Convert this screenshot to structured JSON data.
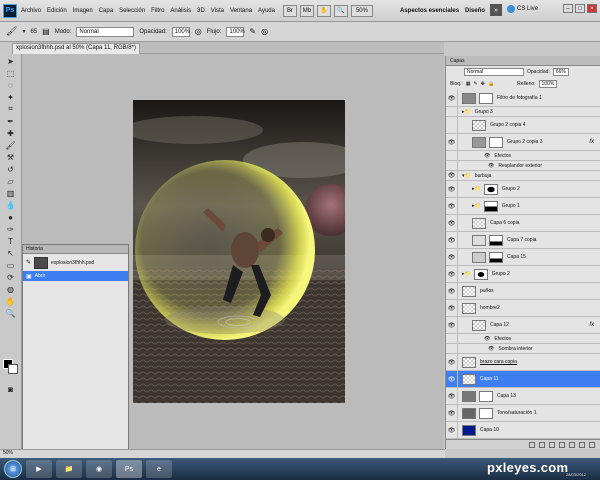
{
  "menubar": {
    "logo": "Ps",
    "menu_items": [
      "Archivo",
      "Edición",
      "Imagen",
      "Capa",
      "Selección",
      "Filtro",
      "Análisis",
      "3D",
      "Vista",
      "Ventana",
      "Ayuda"
    ],
    "zoom": "50%",
    "workspace_1": "Aspectos esenciales",
    "workspace_2": "Diseño",
    "expand_label": "»",
    "cs_live": "CS Live"
  },
  "options_bar": {
    "mode_label": "Modo:",
    "mode_value": "Normal",
    "opacity_label": "Opacidad:",
    "opacity_value": "100%",
    "flow_label": "Flujo:",
    "flow_value": "100%",
    "brush_size": "65"
  },
  "document": {
    "tab_title": "xplosion3fhhh.psd al 50% (Capa 11, RGB/8*)",
    "status_zoom": "50%"
  },
  "history": {
    "title": "Historia",
    "items": [
      {
        "label": "explosion3fhhh.psd"
      },
      {
        "label": "Abrir"
      }
    ]
  },
  "layers": {
    "tab_label": "Capas",
    "blend_mode": "Normal",
    "opacity_label": "Opacidad:",
    "opacity_value": "66%",
    "lock_label": "Bloq.:",
    "fill_label": "Relleno:",
    "fill_value": "100%",
    "rows": [
      {
        "name": "Filtro de fotografía 1"
      },
      {
        "name": "Grupo 3"
      },
      {
        "name": "Grupo 2 copia 4"
      },
      {
        "name": "Grupo 2 copia 3"
      },
      {
        "name": "Efectos"
      },
      {
        "name": "Resplandor exterior"
      },
      {
        "name": "burbuja"
      },
      {
        "name": "Grupo 2"
      },
      {
        "name": "Grupo 1"
      },
      {
        "name": "Capa 6 copia"
      },
      {
        "name": "Capa 7 copia"
      },
      {
        "name": "Capa 15"
      },
      {
        "name": "Grupo 2"
      },
      {
        "name": "puños"
      },
      {
        "name": "hombre2"
      },
      {
        "name": "Capa 12"
      },
      {
        "name": "Efectos"
      },
      {
        "name": "Sombra interior"
      },
      {
        "name": "brazo cara copia"
      },
      {
        "name": "Capa 11"
      },
      {
        "name": "Capa 13"
      },
      {
        "name": "Tono/saturación 1"
      },
      {
        "name": "Capa 10"
      }
    ],
    "fx_label": "fx"
  },
  "taskbar": {
    "ps_label": "Ps",
    "watermark": "pxleyes.com",
    "date": "28/03/2012"
  },
  "colors": {
    "selection_blue": "#3d7ff3",
    "foreground": "#000000",
    "background": "#ffffff"
  }
}
